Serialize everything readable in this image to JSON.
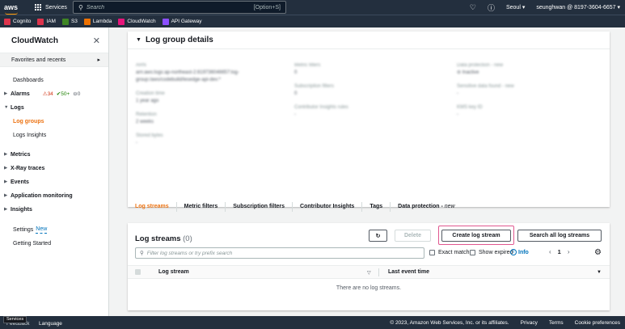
{
  "topnav": {
    "logo": "aws",
    "services_label": "Services",
    "search_placeholder": "Search",
    "search_shortcut": "[Option+S]",
    "region": "Seoul",
    "account": "seunghwan @ 8197-3604-6657"
  },
  "favorites": [
    {
      "label": "Cognito",
      "color": "#dd344c"
    },
    {
      "label": "IAM",
      "color": "#dd344c"
    },
    {
      "label": "S3",
      "color": "#3f8624"
    },
    {
      "label": "Lambda",
      "color": "#ed7100"
    },
    {
      "label": "CloudWatch",
      "color": "#e7157b"
    },
    {
      "label": "API Gateway",
      "color": "#8c4fff"
    }
  ],
  "sidebar": {
    "title": "CloudWatch",
    "favorites_label": "Favorites and recents",
    "dashboards": "Dashboards",
    "alarms": "Alarms",
    "alarm_stats": {
      "red": "34",
      "green": "50+",
      "grey": "0"
    },
    "logs": "Logs",
    "log_groups": "Log groups",
    "logs_insights": "Logs Insights",
    "metrics": "Metrics",
    "xray": "X-Ray traces",
    "events": "Events",
    "app_monitoring": "Application monitoring",
    "insights": "Insights",
    "settings": "Settings",
    "settings_new": "New",
    "getting_started": "Getting Started"
  },
  "details": {
    "title": "Log group details"
  },
  "tabs": [
    {
      "label": "Log streams",
      "active": true
    },
    {
      "label": "Metric filters"
    },
    {
      "label": "Subscription filters"
    },
    {
      "label": "Contributor Insights"
    },
    {
      "label": "Tags"
    },
    {
      "label": "Data protection - ",
      "suffix": "new"
    }
  ],
  "streams": {
    "title": "Log streams",
    "count": "(0)",
    "delete_label": "Delete",
    "create_label": "Create log stream",
    "search_all_label": "Search all log streams",
    "filter_placeholder": "Filter log streams or try prefix search",
    "exact_match": "Exact match",
    "show_expired": "Show expired",
    "info": "Info",
    "page": "1",
    "col_stream": "Log stream",
    "col_last_event": "Last event time",
    "empty": "There are no log streams."
  },
  "footer": {
    "feedback": "Feedback",
    "tooltip": "Services",
    "language": "Language",
    "copyright": "© 2023, Amazon Web Services, Inc. or its affiliates.",
    "privacy": "Privacy",
    "terms": "Terms",
    "cookies": "Cookie preferences"
  }
}
